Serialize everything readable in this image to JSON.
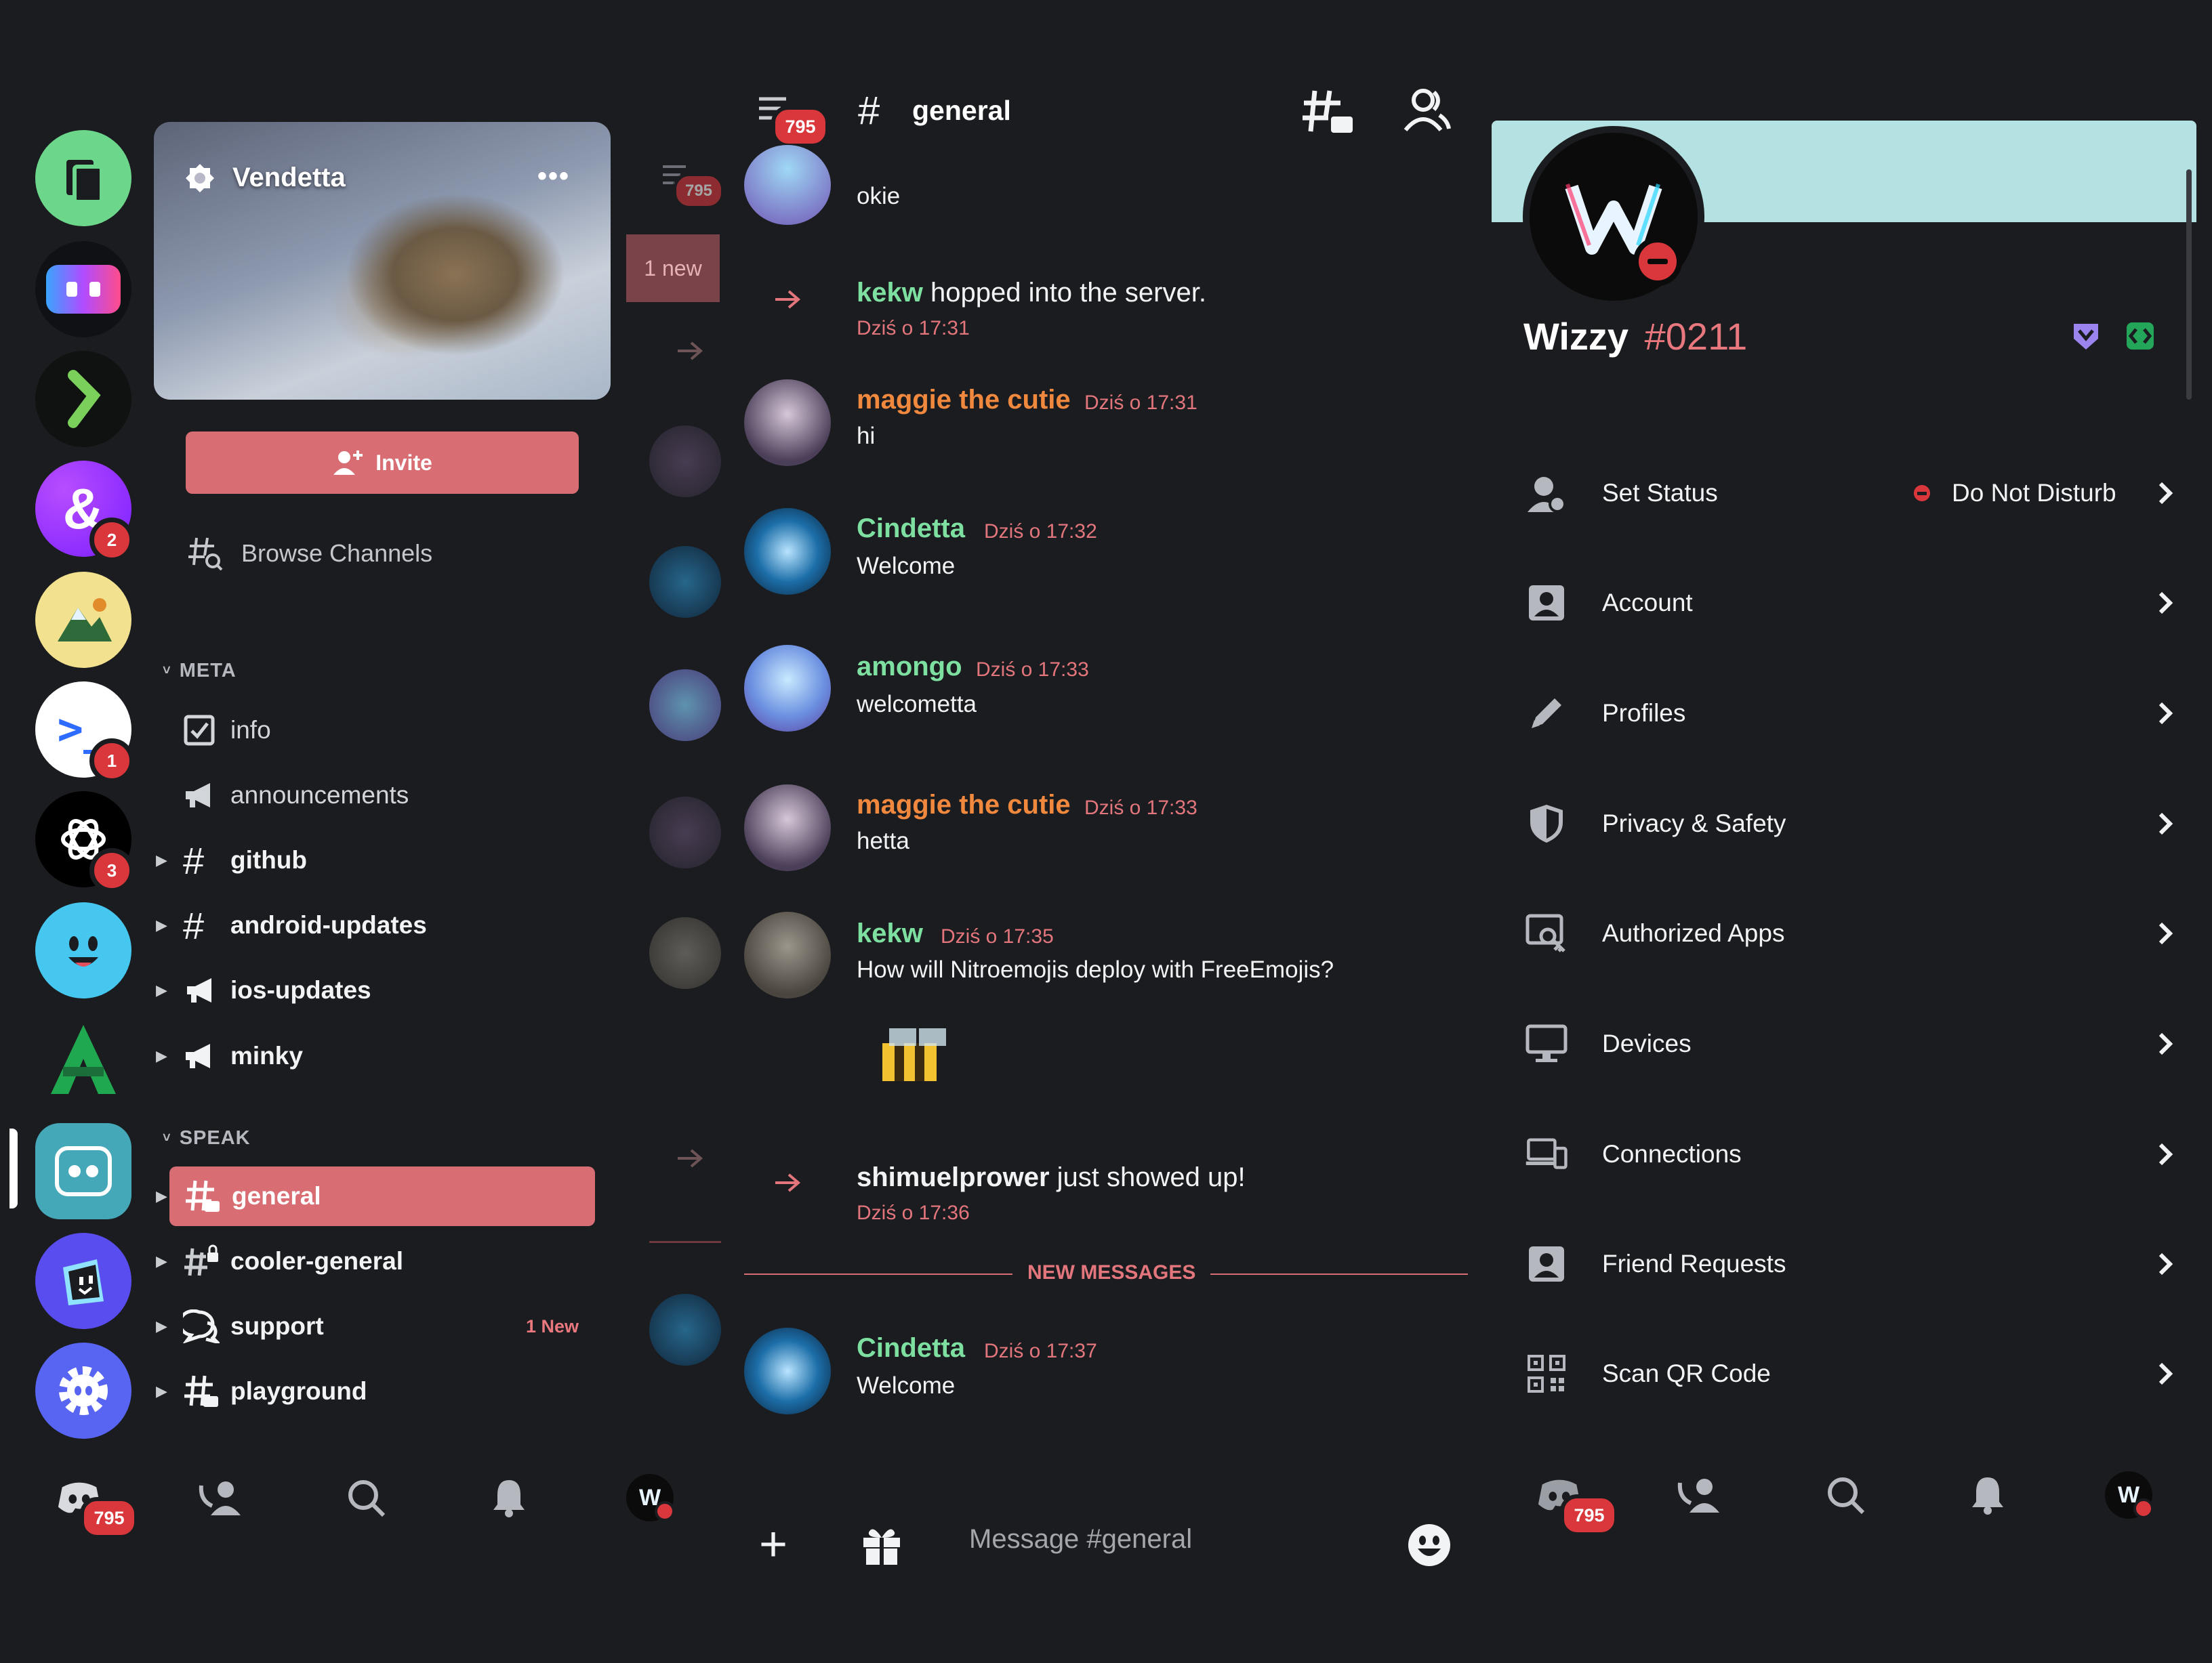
{
  "servers": [
    {
      "name": "files-server",
      "badge": ""
    },
    {
      "name": "bot-server",
      "badge": ""
    },
    {
      "name": "green-s-server",
      "badge": ""
    },
    {
      "name": "ampersand-server",
      "badge": "2"
    },
    {
      "name": "python-server",
      "badge": ""
    },
    {
      "name": "terminal-server",
      "badge": "1"
    },
    {
      "name": "openai-server",
      "badge": "3"
    },
    {
      "name": "smiley-server",
      "badge": ""
    },
    {
      "name": "green-a-server",
      "badge": ""
    },
    {
      "name": "vendetta-server",
      "badge": ""
    },
    {
      "name": "purple-box-server",
      "badge": ""
    },
    {
      "name": "settings-server",
      "badge": ""
    }
  ],
  "server_header": {
    "name": "Vendetta",
    "more": "•••"
  },
  "invite_label": "Invite",
  "browse_label": "Browse Channels",
  "categories": {
    "meta": "META",
    "speak": "SPEAK"
  },
  "channels_meta": [
    {
      "name": "info"
    },
    {
      "name": "announcements"
    },
    {
      "name": "github"
    },
    {
      "name": "android-updates"
    },
    {
      "name": "ios-updates"
    },
    {
      "name": "minky"
    }
  ],
  "channels_speak": [
    {
      "name": "general"
    },
    {
      "name": "cooler-general"
    },
    {
      "name": "support",
      "new": "1 New"
    },
    {
      "name": "playground"
    }
  ],
  "chat": {
    "badge": "795",
    "channel": "general",
    "mini_badge": "795",
    "mini_new": "1 new",
    "first_text": "okie",
    "sys1": {
      "user": "kekw",
      "text": " hopped into the server.",
      "ts": "Dziś o 17:31"
    },
    "messages": [
      {
        "user": "maggie the cutie",
        "ts": "Dziś o 17:31",
        "text": "hi"
      },
      {
        "user": "Cindetta",
        "ts": "Dziś o 17:32",
        "text": "Welcome"
      },
      {
        "user": "amongo",
        "ts": "Dziś o 17:33",
        "text": "welcometta"
      },
      {
        "user": "maggie the cutie",
        "ts": "Dziś o 17:33",
        "text": "hetta"
      },
      {
        "user": "kekw",
        "ts": "Dziś o 17:35",
        "text": "How will Nitroemojis deploy with FreeEmojis?"
      }
    ],
    "sys2": {
      "user": "shimuelprower",
      "text": " just showed up!",
      "ts": "Dziś o 17:36"
    },
    "new_messages": "NEW MESSAGES",
    "last": {
      "user": "Cindetta",
      "ts": "Dziś o 17:37",
      "text": "Welcome"
    },
    "placeholder": "Message #general"
  },
  "profile": {
    "name": "Wizzy",
    "discriminator": "#0211",
    "status_value": "Do Not Disturb"
  },
  "settings": [
    {
      "label": "Set Status",
      "icon": "status-icon"
    },
    {
      "label": "Account",
      "icon": "account-icon"
    },
    {
      "label": "Profiles",
      "icon": "pencil-icon"
    },
    {
      "label": "Privacy & Safety",
      "icon": "shield-icon"
    },
    {
      "label": "Authorized Apps",
      "icon": "authorized-apps-icon"
    },
    {
      "label": "Devices",
      "icon": "monitor-icon"
    },
    {
      "label": "Connections",
      "icon": "connections-icon"
    },
    {
      "label": "Friend Requests",
      "icon": "friend-requests-icon"
    },
    {
      "label": "Scan QR Code",
      "icon": "qr-code-icon"
    }
  ],
  "nav": {
    "left_badge": "795",
    "right_badge": "795"
  },
  "colors": {
    "accent": "#d96d74",
    "username_orange": "#f0883e",
    "username_green": "#7ee0a0",
    "background": "#1b1c1f",
    "dnd_red": "#da373c"
  }
}
